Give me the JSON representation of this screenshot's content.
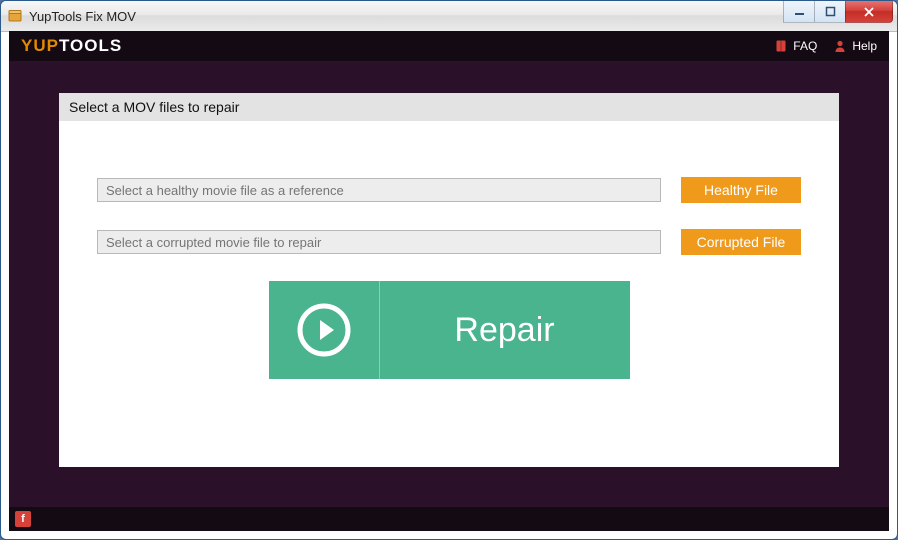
{
  "window": {
    "title": "YupTools Fix MOV"
  },
  "brand": {
    "part1": "YUP",
    "part2": "TOOLS"
  },
  "header": {
    "faq_label": "FAQ",
    "help_label": "Help"
  },
  "panel": {
    "title": "Select a MOV files to repair",
    "healthy_placeholder": "Select a healthy movie file as a reference",
    "corrupted_placeholder": "Select a corrupted movie file to repair",
    "healthy_value": "",
    "corrupted_value": "",
    "healthy_btn": "Healthy File",
    "corrupted_btn": "Corrupted File",
    "repair_label": "Repair"
  },
  "footer": {
    "fb_label": "f"
  },
  "colors": {
    "accent": "#f09a1b",
    "action": "#4ab48e",
    "bg": "#2a1129"
  }
}
